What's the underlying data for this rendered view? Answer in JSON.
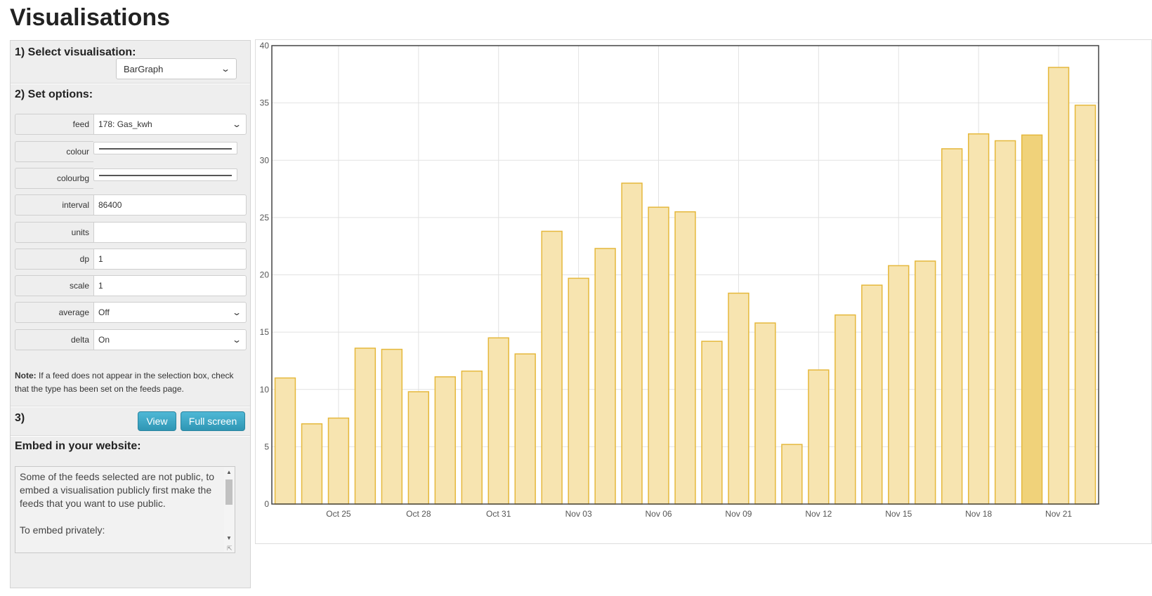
{
  "page": {
    "title": "Visualisations"
  },
  "steps": {
    "select_label": "1) Select visualisation:",
    "options_label": "2) Set options:",
    "step3_label": "3)",
    "embed_label": "Embed in your website:"
  },
  "visualisation": {
    "selected": "BarGraph"
  },
  "options": {
    "feed": {
      "label": "feed",
      "value": "178: Gas_kwh"
    },
    "colour": {
      "label": "colour"
    },
    "colourbg": {
      "label": "colourbg"
    },
    "interval": {
      "label": "interval",
      "value": "86400"
    },
    "units": {
      "label": "units",
      "value": ""
    },
    "dp": {
      "label": "dp",
      "value": "1"
    },
    "scale": {
      "label": "scale",
      "value": "1"
    },
    "average": {
      "label": "average",
      "value": "Off"
    },
    "delta": {
      "label": "delta",
      "value": "On"
    }
  },
  "note": {
    "bold": "Note:",
    "text": " If a feed does not appear in the selection box, check that the type has been set on the feeds page."
  },
  "buttons": {
    "view": "View",
    "fullscreen": "Full screen"
  },
  "embed": {
    "text1": "Some of the feeds selected are not public, to embed a visualisation publicly first make the feeds that you want to use public.",
    "text2": "To embed privately:"
  },
  "colors": {
    "bar_fill": "#f7e4b0",
    "bar_stroke": "#e5b83c",
    "bar_highlight": "#f0d27a",
    "button": "#2f96b4"
  },
  "chart_data": {
    "type": "bar",
    "x": [
      "Oct 23",
      "Oct 24",
      "Oct 25",
      "Oct 26",
      "Oct 27",
      "Oct 28",
      "Oct 29",
      "Oct 30",
      "Oct 31",
      "Nov 01",
      "Nov 02",
      "Nov 03",
      "Nov 04",
      "Nov 05",
      "Nov 06",
      "Nov 07",
      "Nov 08",
      "Nov 09",
      "Nov 10",
      "Nov 11",
      "Nov 12",
      "Nov 13",
      "Nov 14",
      "Nov 15",
      "Nov 16",
      "Nov 17",
      "Nov 18",
      "Nov 19",
      "Nov 20",
      "Nov 21",
      "Nov 22"
    ],
    "values": [
      11.0,
      7.0,
      7.5,
      13.6,
      13.5,
      9.8,
      11.1,
      11.6,
      14.5,
      13.1,
      23.8,
      19.7,
      22.3,
      28.0,
      25.9,
      25.5,
      14.2,
      18.4,
      15.8,
      5.2,
      11.7,
      16.5,
      19.1,
      20.8,
      21.2,
      31.0,
      32.3,
      31.7,
      32.2,
      38.1,
      34.8
    ],
    "xticks": [
      "Oct 25",
      "Oct 28",
      "Oct 31",
      "Nov 03",
      "Nov 06",
      "Nov 09",
      "Nov 12",
      "Nov 15",
      "Nov 18",
      "Nov 21"
    ],
    "yticks": [
      0,
      5,
      10,
      15,
      20,
      25,
      30,
      35,
      40
    ],
    "ylim": [
      0,
      40
    ],
    "highlight_index": 28,
    "grid": true,
    "title": "",
    "xlabel": "",
    "ylabel": ""
  }
}
